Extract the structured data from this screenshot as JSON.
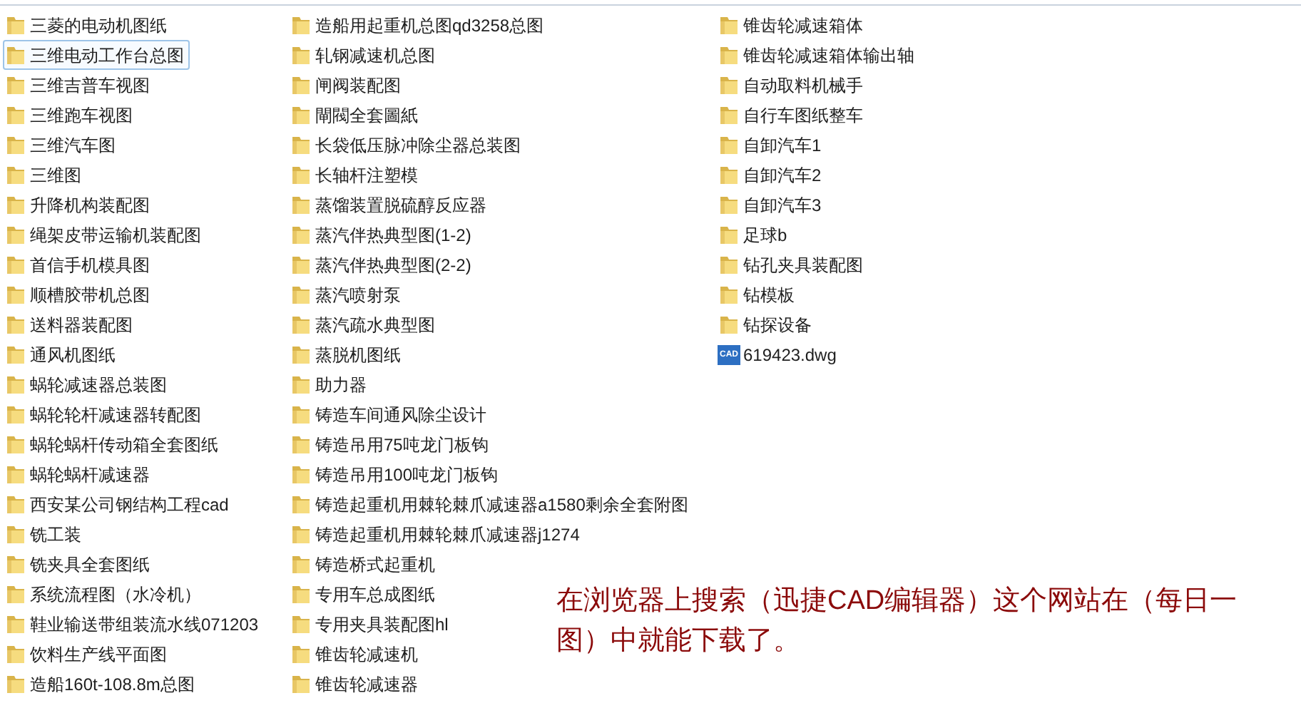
{
  "columns": [
    [
      {
        "name": "三菱的电动机图纸",
        "kind": "folder",
        "focused": false
      },
      {
        "name": "三维电动工作台总图",
        "kind": "folder",
        "focused": true
      },
      {
        "name": "三维吉普车视图",
        "kind": "folder",
        "focused": false
      },
      {
        "name": "三维跑车视图",
        "kind": "folder",
        "focused": false
      },
      {
        "name": "三维汽车图",
        "kind": "folder",
        "focused": false
      },
      {
        "name": "三维图",
        "kind": "folder",
        "focused": false
      },
      {
        "name": "升降机构装配图",
        "kind": "folder",
        "focused": false
      },
      {
        "name": "绳架皮带运输机装配图",
        "kind": "folder",
        "focused": false
      },
      {
        "name": "首信手机模具图",
        "kind": "folder",
        "focused": false
      },
      {
        "name": "顺槽胶带机总图",
        "kind": "folder",
        "focused": false
      },
      {
        "name": "送料器装配图",
        "kind": "folder",
        "focused": false
      },
      {
        "name": "通风机图纸",
        "kind": "folder",
        "focused": false
      },
      {
        "name": "蜗轮减速器总装图",
        "kind": "folder",
        "focused": false
      },
      {
        "name": "蜗轮轮杆减速器转配图",
        "kind": "folder",
        "focused": false
      },
      {
        "name": "蜗轮蜗杆传动箱全套图纸",
        "kind": "folder",
        "focused": false
      },
      {
        "name": "蜗轮蜗杆减速器",
        "kind": "folder",
        "focused": false
      },
      {
        "name": "西安某公司钢结构工程cad",
        "kind": "folder",
        "focused": false
      },
      {
        "name": "铣工装",
        "kind": "folder",
        "focused": false
      },
      {
        "name": "铣夹具全套图纸",
        "kind": "folder",
        "focused": false
      },
      {
        "name": "系统流程图（水冷机）",
        "kind": "folder",
        "focused": false
      },
      {
        "name": "鞋业输送带组装流水线071203",
        "kind": "folder",
        "focused": false
      },
      {
        "name": "饮料生产线平面图",
        "kind": "folder",
        "focused": false
      },
      {
        "name": "造船160t-108.8m总图",
        "kind": "folder",
        "focused": false
      }
    ],
    [
      {
        "name": "造船用起重机总图qd3258总图",
        "kind": "folder",
        "focused": false
      },
      {
        "name": "轧钢减速机总图",
        "kind": "folder",
        "focused": false
      },
      {
        "name": "闸阀装配图",
        "kind": "folder",
        "focused": false
      },
      {
        "name": "閘閥全套圖紙",
        "kind": "folder",
        "focused": false
      },
      {
        "name": "长袋低压脉冲除尘器总装图",
        "kind": "folder",
        "focused": false
      },
      {
        "name": "长轴杆注塑模",
        "kind": "folder",
        "focused": false
      },
      {
        "name": "蒸馏装置脱硫醇反应器",
        "kind": "folder",
        "focused": false
      },
      {
        "name": "蒸汽伴热典型图(1-2)",
        "kind": "folder",
        "focused": false
      },
      {
        "name": "蒸汽伴热典型图(2-2)",
        "kind": "folder",
        "focused": false
      },
      {
        "name": "蒸汽喷射泵",
        "kind": "folder",
        "focused": false
      },
      {
        "name": "蒸汽疏水典型图",
        "kind": "folder",
        "focused": false
      },
      {
        "name": "蒸脱机图纸",
        "kind": "folder",
        "focused": false
      },
      {
        "name": "助力器",
        "kind": "folder",
        "focused": false
      },
      {
        "name": "铸造车间通风除尘设计",
        "kind": "folder",
        "focused": false
      },
      {
        "name": "铸造吊用75吨龙门板钩",
        "kind": "folder",
        "focused": false
      },
      {
        "name": "铸造吊用100吨龙门板钩",
        "kind": "folder",
        "focused": false
      },
      {
        "name": "铸造起重机用棘轮棘爪减速器a1580剩余全套附图",
        "kind": "folder",
        "focused": false
      },
      {
        "name": "铸造起重机用棘轮棘爪减速器j1274",
        "kind": "folder",
        "focused": false
      },
      {
        "name": "铸造桥式起重机",
        "kind": "folder",
        "focused": false
      },
      {
        "name": "专用车总成图纸",
        "kind": "folder",
        "focused": false
      },
      {
        "name": "专用夹具装配图hl",
        "kind": "folder",
        "focused": false
      },
      {
        "name": "锥齿轮减速机",
        "kind": "folder",
        "focused": false
      },
      {
        "name": "锥齿轮减速器",
        "kind": "folder",
        "focused": false
      }
    ],
    [
      {
        "name": "锥齿轮减速箱体",
        "kind": "folder",
        "focused": false
      },
      {
        "name": "锥齿轮减速箱体输出轴",
        "kind": "folder",
        "focused": false
      },
      {
        "name": "自动取料机械手",
        "kind": "folder",
        "focused": false
      },
      {
        "name": "自行车图纸整车",
        "kind": "folder",
        "focused": false
      },
      {
        "name": "自卸汽车1",
        "kind": "folder",
        "focused": false
      },
      {
        "name": "自卸汽车2",
        "kind": "folder",
        "focused": false
      },
      {
        "name": "自卸汽车3",
        "kind": "folder",
        "focused": false
      },
      {
        "name": "足球b",
        "kind": "folder",
        "focused": false
      },
      {
        "name": "钻孔夹具装配图",
        "kind": "folder",
        "focused": false
      },
      {
        "name": "钻模板",
        "kind": "folder",
        "focused": false
      },
      {
        "name": "钻探设备",
        "kind": "folder",
        "focused": false
      },
      {
        "name": "619423.dwg",
        "kind": "cad",
        "focused": false,
        "icon_text": "CAD"
      }
    ]
  ],
  "caption": "在浏览器上搜索（迅捷CAD编辑器）这个网站在（每日一图）中就能下载了。"
}
